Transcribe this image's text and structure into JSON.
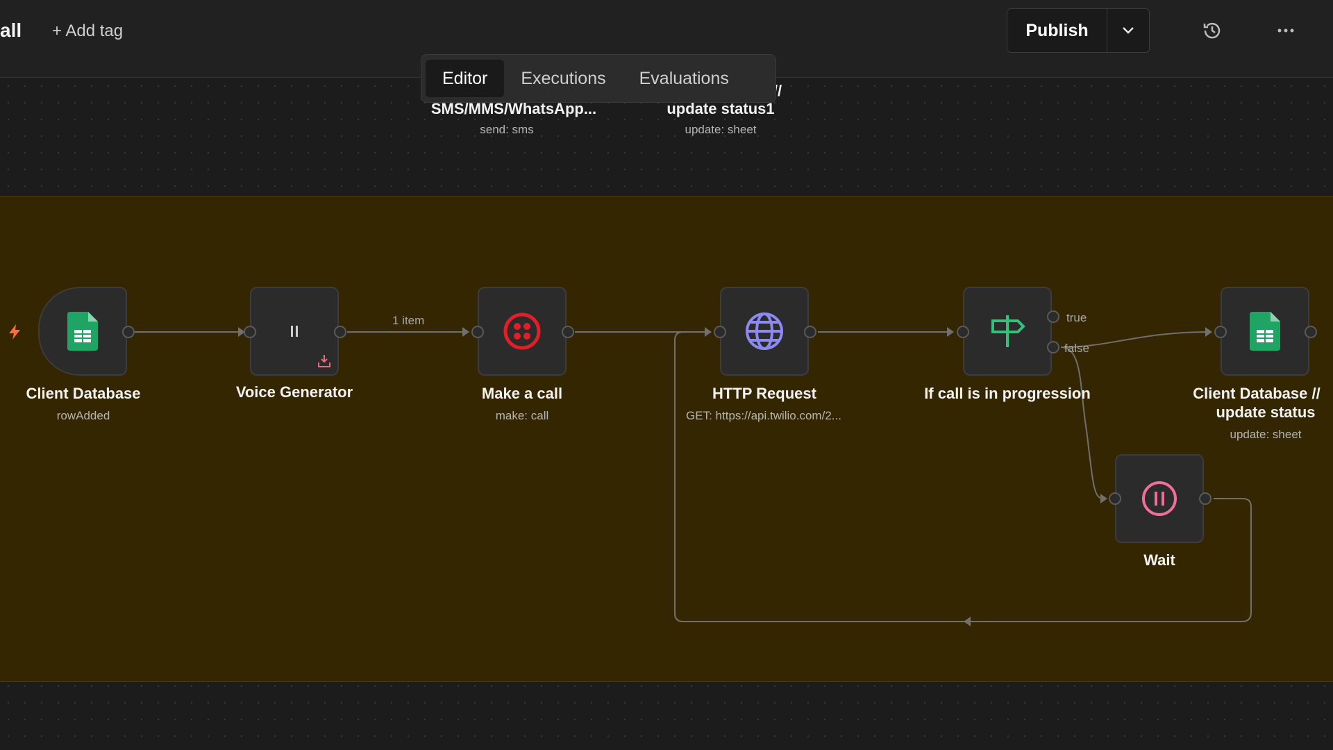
{
  "header": {
    "workflow_name": "all",
    "add_tag": "+ Add tag",
    "publish_label": "Publish"
  },
  "tabs": [
    "Editor",
    "Executions",
    "Evaluations"
  ],
  "top_nodes": [
    {
      "title_fragment": "//",
      "title": "SMS/MMS/WhatsApp...",
      "subtitle": "send: sms"
    },
    {
      "title": "update status1",
      "subtitle": "update: sheet"
    }
  ],
  "nodes": {
    "client_db": {
      "label": "Client Database",
      "sub": "rowAdded"
    },
    "voice": {
      "label": "Voice Generator"
    },
    "call": {
      "label": "Make a call",
      "sub": "make: call"
    },
    "http": {
      "label": "HTTP Request",
      "sub": "GET: https://api.twilio.com/2..."
    },
    "ifnode": {
      "label": "If call is in progression",
      "true_label": "true",
      "false_label": "false"
    },
    "client_db2": {
      "label": "Client Database //",
      "label2": "update status",
      "sub": "update: sheet"
    },
    "wait": {
      "label": "Wait"
    }
  },
  "edge_labels": {
    "voice_to_call": "1 item"
  },
  "colors": {
    "sticky_bg": "#332600",
    "sheets_green": "#1fa463",
    "twilio_red": "#e31e26",
    "http_purple": "#8c89f0",
    "if_green": "#35c17b",
    "wait_pink": "#ef6f9a",
    "trigger_orange": "#ff6d3a"
  }
}
